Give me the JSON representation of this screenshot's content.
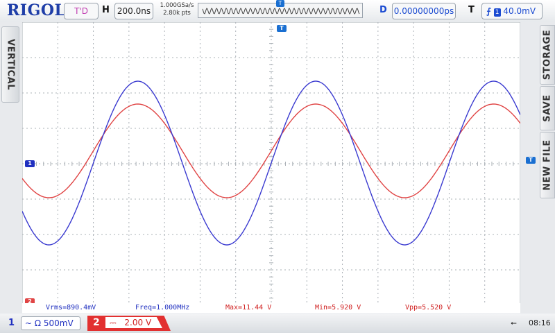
{
  "brand": "RIGOL",
  "header": {
    "run_state": "T'D",
    "h_label": "H",
    "timebase": "200.0ns",
    "sample_rate": "1.000GSa/s",
    "memory_depth": "2.80k pts",
    "trigger_marker": "T",
    "d_label": "D",
    "delay": "0.00000000ps",
    "t_label": "T",
    "trigger_source": "1",
    "trigger_level": "40.0mV"
  },
  "left_menu": {
    "vertical": "VERTICAL"
  },
  "right_menu": {
    "storage": "STORAGE",
    "save": "SAVE",
    "new_file": "NEW FILE"
  },
  "markers": {
    "ch1_ground": "1",
    "ch2_ground": "2",
    "trigger_level_marker": "T"
  },
  "measurements": {
    "vrms": "Vrms=890.4mV",
    "freq": "Freq=1.000MHz",
    "max": "Max=11.44 V",
    "min": "Min=5.920 V",
    "vpp": "Vpp=5.520 V"
  },
  "footer": {
    "ch1_number": "1",
    "ch1_coupling": "~ Ω",
    "ch1_scale": "500mV",
    "ch2_number": "2",
    "ch2_coupling": "⎓",
    "ch2_scale": "2.00 V",
    "time": "08:16"
  },
  "colors": {
    "ch1": "#3a3ad0",
    "ch2": "#e04444",
    "grid": "#aab0b6"
  },
  "chart_data": {
    "type": "line",
    "grid": {
      "divisions_x": 14,
      "divisions_y": 8,
      "on": true
    },
    "series": [
      {
        "name": "1",
        "color": "#3a3ad0",
        "frequency_cycles_per_screen": 2.8,
        "peak": 119,
        "trough": -117
      },
      {
        "name": "2",
        "color": "#e04444",
        "frequency_cycles_per_screen": 2.8,
        "peak": 86,
        "trough": -49
      }
    ]
  }
}
